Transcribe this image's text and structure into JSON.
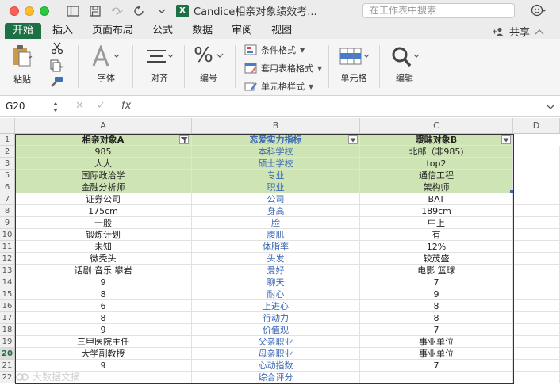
{
  "window": {
    "title": "Candice相亲对象绩效考...",
    "search_placeholder": "在工作表中搜索"
  },
  "tabs": [
    {
      "label": "开始",
      "active": true
    },
    {
      "label": "插入"
    },
    {
      "label": "页面布局"
    },
    {
      "label": "公式"
    },
    {
      "label": "数据"
    },
    {
      "label": "审阅"
    },
    {
      "label": "视图"
    }
  ],
  "share_label": "共享",
  "ribbon": {
    "paste": "粘贴",
    "font": "字体",
    "align": "对齐",
    "number": "编号",
    "cond_format": "条件格式",
    "table_format": "套用表格格式",
    "cell_style": "单元格样式",
    "cells": "单元格",
    "edit": "编辑"
  },
  "formula_bar": {
    "name_box": "G20",
    "fx": "fx",
    "content": ""
  },
  "columns": [
    "A",
    "B",
    "C",
    "D"
  ],
  "header_row": {
    "a": "相亲对象A",
    "b": "恋爱实力指标",
    "c": "暧昧对象B"
  },
  "rows": [
    {
      "n": "2",
      "a": "985",
      "b": "本科学校",
      "c": "北邮（非985)"
    },
    {
      "n": "3",
      "a": "人大",
      "b": "硕士学校",
      "c": "top2"
    },
    {
      "n": "5",
      "a": "国际政治学",
      "b": "专业",
      "c": "通信工程"
    },
    {
      "n": "6",
      "a": "金融分析师",
      "b": "职业",
      "c": "架构师"
    },
    {
      "n": "7",
      "a": "证券公司",
      "b": "公司",
      "c": "BAT"
    },
    {
      "n": "8",
      "a": "175cm",
      "b": "身高",
      "c": "189cm"
    },
    {
      "n": "9",
      "a": "一般",
      "b": "脸",
      "c": "中上"
    },
    {
      "n": "10",
      "a": "锻炼计划",
      "b": "腹肌",
      "c": "有"
    },
    {
      "n": "11",
      "a": "未知",
      "b": "体脂率",
      "c": "12%"
    },
    {
      "n": "12",
      "a": "微秃头",
      "b": "头发",
      "c": "较茂盛"
    },
    {
      "n": "13",
      "a": "话剧 音乐 攀岩",
      "b": "爱好",
      "c": "电影 篮球"
    },
    {
      "n": "14",
      "a": "9",
      "b": "聊天",
      "c": "7"
    },
    {
      "n": "15",
      "a": "8",
      "b": "耐心",
      "c": "9"
    },
    {
      "n": "16",
      "a": "6",
      "b": "上进心",
      "c": "8"
    },
    {
      "n": "17",
      "a": "8",
      "b": "行动力",
      "c": "8"
    },
    {
      "n": "18",
      "a": "9",
      "b": "价值观",
      "c": "7"
    },
    {
      "n": "19",
      "a": "三甲医院主任",
      "b": "父亲职业",
      "c": "事业单位"
    },
    {
      "n": "20",
      "a": "大学副教授",
      "b": "母亲职业",
      "c": "事业单位"
    },
    {
      "n": "21",
      "a": "9",
      "b": "心动指数",
      "c": "7"
    },
    {
      "n": "22",
      "a": "",
      "b": "综合评分",
      "c": ""
    }
  ],
  "row1_label": "1",
  "watermark": "大数据文摘",
  "colors": {
    "accent": "#1d7044",
    "header_fill": "#cfe4b4",
    "indicator_text": "#3a68b4"
  }
}
